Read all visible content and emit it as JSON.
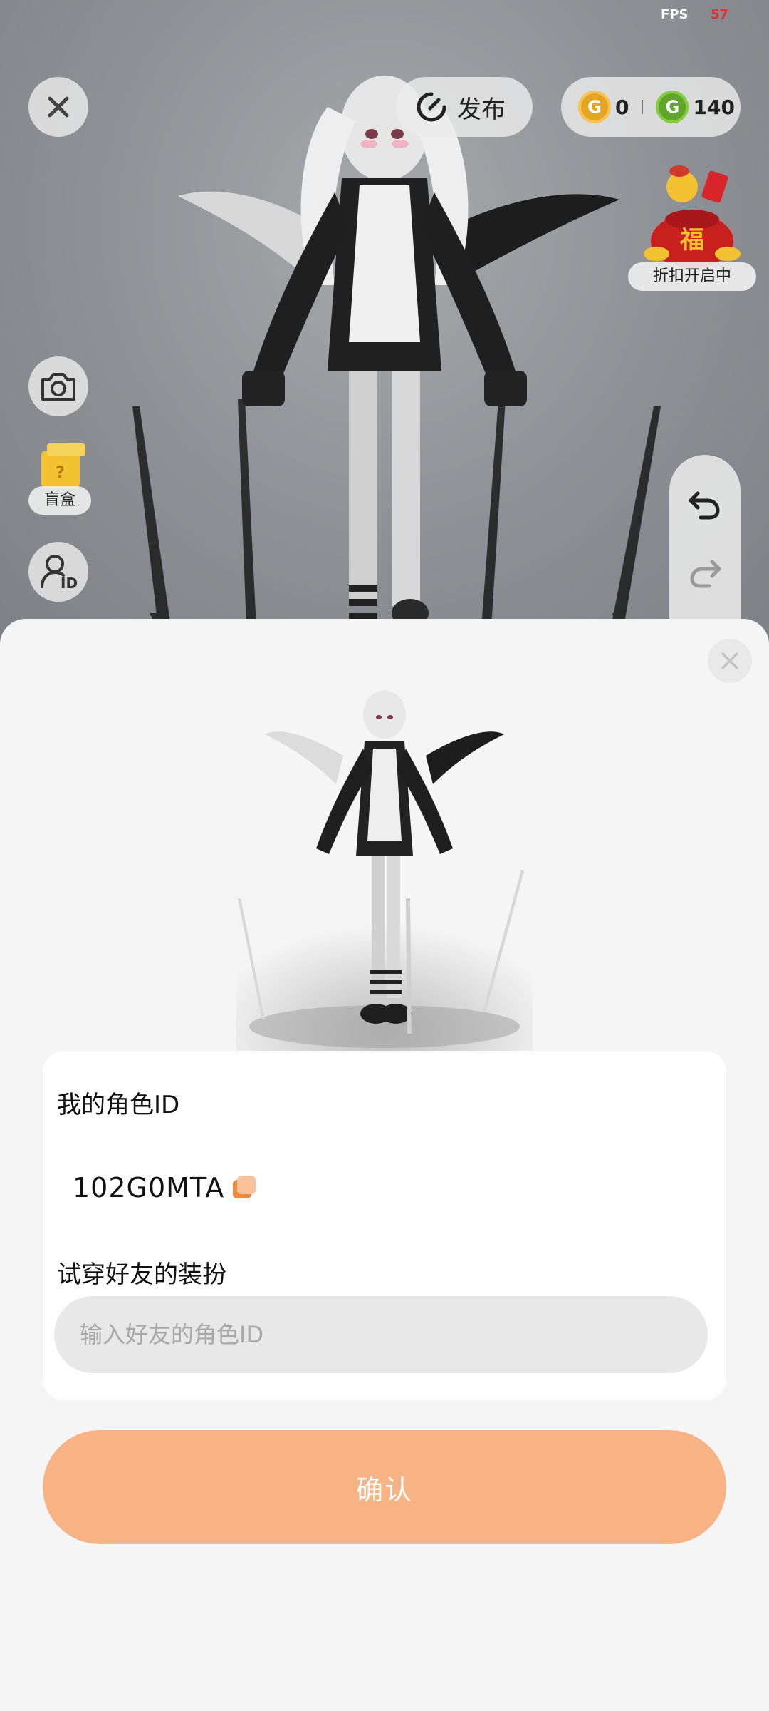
{
  "status": {
    "fps_label": "FPS",
    "fps_value": "57"
  },
  "header": {
    "publish_label": "发布",
    "currency": {
      "gold_value": "0",
      "green_value": "140"
    },
    "promo_label": "折扣开启中",
    "promo_badge": "福"
  },
  "side": {
    "blind_box_label": "盲盒",
    "blind_box_mark": "?",
    "id_badge": "ID"
  },
  "sheet": {
    "my_id_label": "我的角色ID",
    "my_id_value": "102G0MTA",
    "try_on_label": "试穿好友的装扮",
    "friend_id_placeholder": "输入好友的角色ID",
    "confirm_label": "确认"
  },
  "colors": {
    "accent": "#f8b384",
    "gold": "#e5a524",
    "green": "#5fa62a",
    "copy_icon": "#f08a3c"
  },
  "icons": [
    "close-icon",
    "publish-icon",
    "gold-coin-icon",
    "green-coin-icon",
    "camera-icon",
    "profile-id-icon",
    "undo-icon",
    "redo-icon",
    "copy-icon"
  ]
}
